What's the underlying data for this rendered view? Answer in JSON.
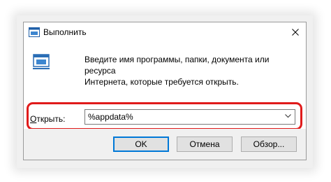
{
  "window": {
    "title": "Выполнить"
  },
  "prompt": {
    "line1": "Введите имя программы, папки, документа или ресурса",
    "line2": "Интернета, которые требуется открыть."
  },
  "open_field": {
    "label_prefix": "",
    "label_hotkey": "О",
    "label_rest": "ткрыть:",
    "value": "%appdata%"
  },
  "buttons": {
    "ok": "OK",
    "cancel": "Отмена",
    "browse": "Обзор..."
  },
  "colors": {
    "highlight": "#e01b1b",
    "accent": "#0078d7"
  }
}
